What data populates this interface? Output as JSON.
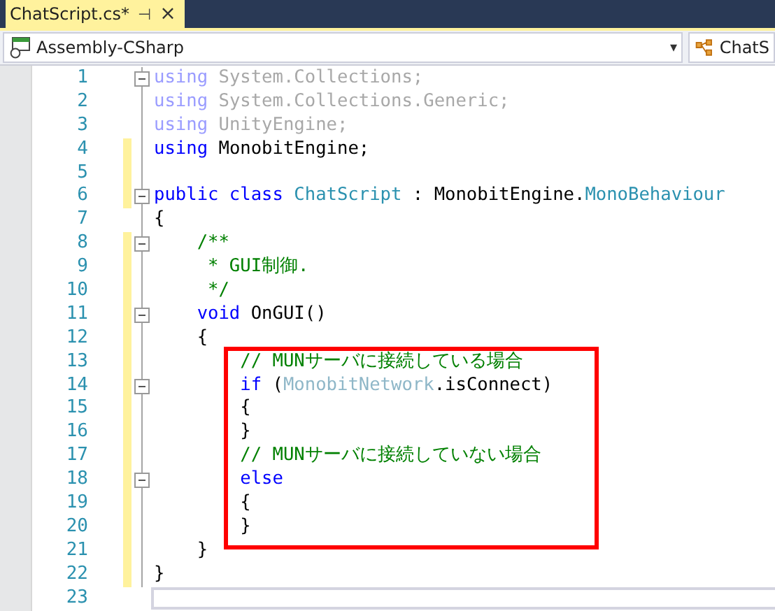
{
  "tab": {
    "title": "ChatScript.cs*",
    "selected": true,
    "pin": "⊣",
    "close": "×"
  },
  "navbar": {
    "project": "Assembly-CSharp",
    "dropdown_arrow": "▾",
    "class_selector": "ChatS"
  },
  "editor": {
    "lines": [
      {
        "number": "1",
        "changed": false,
        "collapsible": true,
        "in_box": false,
        "current": false,
        "tokens": [
          {
            "kind": "dim-keyword",
            "text": "using"
          },
          {
            "kind": "dim",
            "text": " System.Collections;"
          }
        ]
      },
      {
        "number": "2",
        "changed": false,
        "collapsible": false,
        "in_box": false,
        "current": false,
        "tokens": [
          {
            "kind": "dim-keyword",
            "text": "using"
          },
          {
            "kind": "dim",
            "text": " System.Collections.Generic;"
          }
        ]
      },
      {
        "number": "3",
        "changed": false,
        "collapsible": false,
        "in_box": false,
        "current": false,
        "tokens": [
          {
            "kind": "dim-keyword",
            "text": "using"
          },
          {
            "kind": "dim",
            "text": " UnityEngine;"
          }
        ]
      },
      {
        "number": "4",
        "changed": true,
        "collapsible": false,
        "in_box": false,
        "current": false,
        "tokens": [
          {
            "kind": "keyword",
            "text": "using"
          },
          {
            "kind": "plain",
            "text": " MonobitEngine;"
          }
        ]
      },
      {
        "number": "5",
        "changed": true,
        "collapsible": false,
        "in_box": false,
        "current": false
      },
      {
        "number": "6",
        "changed": true,
        "collapsible": true,
        "in_box": false,
        "current": false,
        "tokens": [
          {
            "kind": "keyword",
            "text": "public class"
          },
          {
            "kind": "type",
            "text": " ChatScript"
          },
          {
            "kind": "plain",
            "text": " : MonobitEngine."
          },
          {
            "kind": "type",
            "text": "MonoBehaviour"
          }
        ]
      },
      {
        "number": "7",
        "changed": false,
        "collapsible": false,
        "in_box": false,
        "current": false,
        "tokens": [
          {
            "kind": "plain",
            "text": "{"
          }
        ]
      },
      {
        "number": "8",
        "changed": true,
        "collapsible": true,
        "in_box": false,
        "current": false,
        "tokens": [
          {
            "kind": "comment",
            "text": "    /**"
          }
        ]
      },
      {
        "number": "9",
        "changed": true,
        "collapsible": false,
        "in_box": false,
        "current": false,
        "tokens": [
          {
            "kind": "comment",
            "text": "     * GUI制御."
          }
        ]
      },
      {
        "number": "10",
        "changed": true,
        "collapsible": false,
        "in_box": false,
        "current": false,
        "tokens": [
          {
            "kind": "comment",
            "text": "     */"
          }
        ]
      },
      {
        "number": "11",
        "changed": true,
        "collapsible": true,
        "in_box": false,
        "current": false,
        "tokens": [
          {
            "kind": "keyword",
            "text": "    void"
          },
          {
            "kind": "plain",
            "text": " OnGUI()"
          }
        ]
      },
      {
        "number": "12",
        "changed": true,
        "collapsible": false,
        "in_box": false,
        "current": false,
        "tokens": [
          {
            "kind": "plain",
            "text": "    {"
          }
        ]
      },
      {
        "number": "13",
        "changed": true,
        "collapsible": false,
        "in_box": true,
        "current": false,
        "tokens": [
          {
            "kind": "comment",
            "text": "        // MUNサーバに接続している場合"
          }
        ]
      },
      {
        "number": "14",
        "changed": true,
        "collapsible": true,
        "in_box": true,
        "current": false,
        "tokens": [
          {
            "kind": "keyword",
            "text": "        if"
          },
          {
            "kind": "plain",
            "text": " ("
          },
          {
            "kind": "dim-type",
            "text": "MonobitNetwork"
          },
          {
            "kind": "plain",
            "text": ".isConnect)"
          }
        ]
      },
      {
        "number": "15",
        "changed": true,
        "collapsible": false,
        "in_box": true,
        "current": false,
        "tokens": [
          {
            "kind": "plain",
            "text": "        {"
          }
        ]
      },
      {
        "number": "16",
        "changed": true,
        "collapsible": false,
        "in_box": true,
        "current": false,
        "tokens": [
          {
            "kind": "plain",
            "text": "        }"
          }
        ]
      },
      {
        "number": "17",
        "changed": true,
        "collapsible": false,
        "in_box": true,
        "current": false,
        "tokens": [
          {
            "kind": "comment",
            "text": "        // MUNサーバに接続していない場合"
          }
        ]
      },
      {
        "number": "18",
        "changed": true,
        "collapsible": true,
        "in_box": true,
        "current": false,
        "tokens": [
          {
            "kind": "keyword",
            "text": "        else"
          }
        ]
      },
      {
        "number": "19",
        "changed": true,
        "collapsible": false,
        "in_box": true,
        "current": false,
        "tokens": [
          {
            "kind": "plain",
            "text": "        {"
          }
        ]
      },
      {
        "number": "20",
        "changed": true,
        "collapsible": false,
        "in_box": true,
        "current": false,
        "tokens": [
          {
            "kind": "plain",
            "text": "        }"
          }
        ]
      },
      {
        "number": "21",
        "changed": true,
        "collapsible": false,
        "in_box": false,
        "current": false,
        "tokens": [
          {
            "kind": "plain",
            "text": "    }"
          }
        ]
      },
      {
        "number": "22",
        "changed": true,
        "collapsible": false,
        "in_box": false,
        "current": false,
        "tokens": [
          {
            "kind": "plain",
            "text": "}"
          }
        ]
      },
      {
        "number": "23",
        "changed": false,
        "collapsible": false,
        "in_box": false,
        "current": true
      }
    ]
  }
}
